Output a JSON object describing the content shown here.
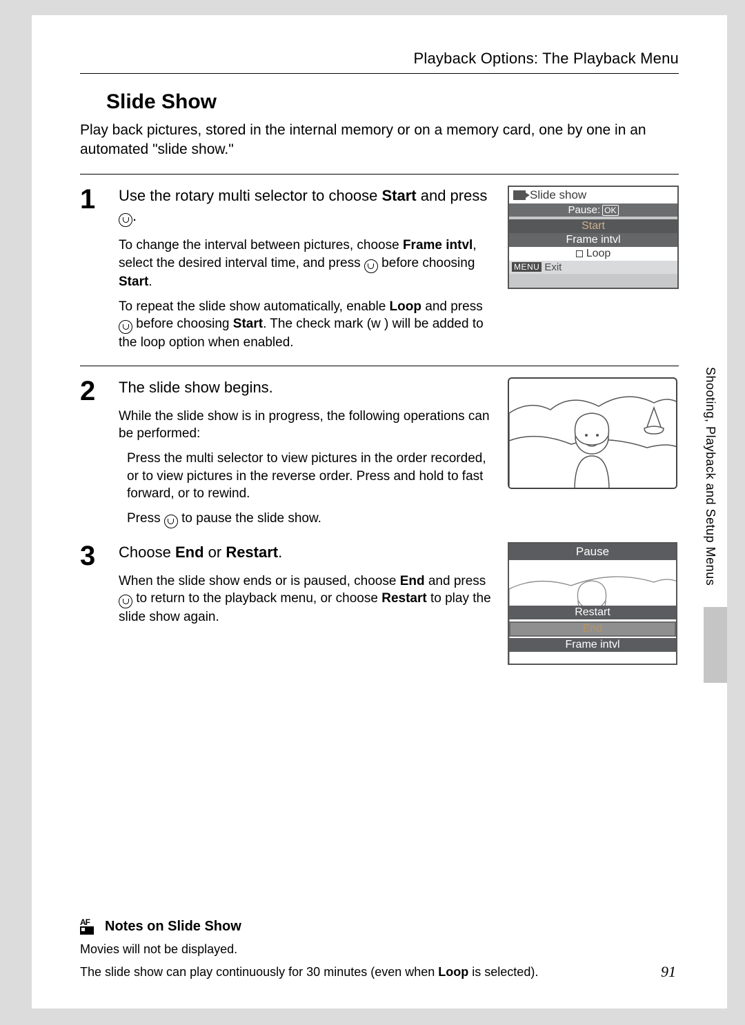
{
  "header": "Playback Options: The Playback Menu",
  "title": "Slide Show",
  "intro": "Play back pictures, stored in the internal memory or on a memory card, one by one in an automated \"slide show.\"",
  "sidebar_text": "Shooting, Playback and Setup Menus",
  "page_number": "91",
  "steps": {
    "s1": {
      "num": "1",
      "head_a": "Use the rotary multi selector to choose ",
      "head_b": "Start",
      "head_c": " and press ",
      "sub1_a": "To change the interval between pictures, choose ",
      "sub1_b": "Frame intvl",
      "sub1_c": ", select the desired interval time, and press ",
      "sub1_d": " before choosing ",
      "sub1_e": "Start",
      "sub2_a": "To repeat the slide show automatically, enable ",
      "sub2_b": "Loop",
      "sub2_c": " and press ",
      "sub2_d": " before choosing ",
      "sub2_e": "Start",
      "sub2_f": ". The check mark (w",
      "sub2_g": ") will be added to the loop option when enabled."
    },
    "s2": {
      "num": "2",
      "head": "The slide show begins.",
      "sub1": "While the slide show is in progress, the following operations can be performed:",
      "sub2": "Press the multi selector      to view pictures in the order recorded, or      to view pictures in the reverse order. Press and hold      to fast forward, or      to rewind.",
      "sub3_a": "Press ",
      "sub3_b": " to pause the slide show."
    },
    "s3": {
      "num": "3",
      "head_a": "Choose ",
      "head_b": "End",
      "head_c": " or ",
      "head_d": "Restart",
      "sub1_a": "When the slide show ends or is paused, choose ",
      "sub1_b": "End",
      "sub1_c": " and press ",
      "sub1_d": " to return to the playback menu, or choose ",
      "sub1_e": "Restart",
      "sub1_f": " to play the slide show again."
    }
  },
  "screen1": {
    "title": "Slide show",
    "pause": "Pause:",
    "ok": "OK",
    "items": {
      "start": "Start",
      "frame": "Frame intvl",
      "loop": "Loop"
    },
    "exit_menu": "MENU",
    "exit": "Exit"
  },
  "screen3": {
    "pause": "Pause",
    "restart": "Restart",
    "end": "End",
    "frame": "Frame intvl"
  },
  "notes": {
    "title": "Notes on Slide Show",
    "line1": "Movies will not be displayed.",
    "line2_a": "The slide show can play continuously for 30 minutes (even when ",
    "line2_b": "Loop",
    "line2_c": " is selected)."
  }
}
